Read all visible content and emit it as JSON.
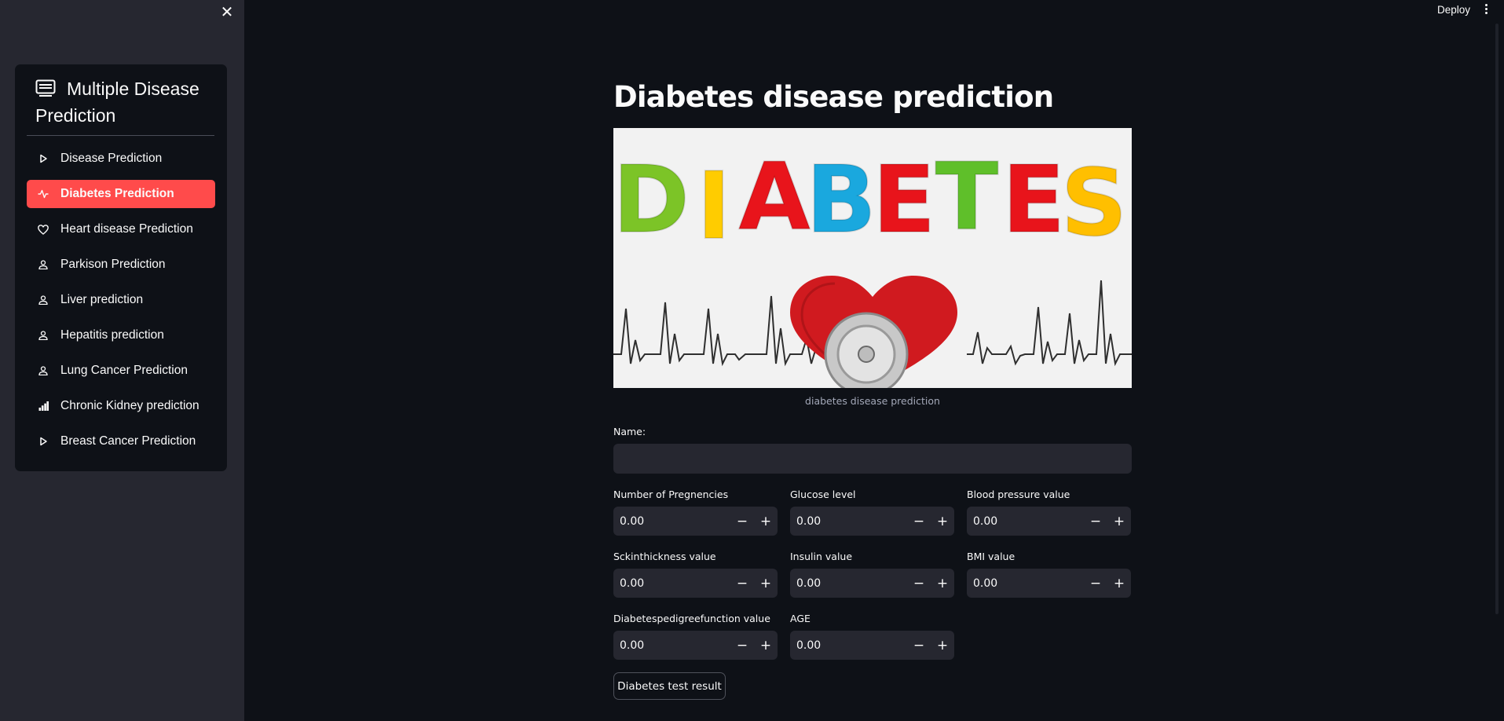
{
  "sidebar": {
    "close_icon": "close-icon",
    "menu": {
      "title": "Multiple Disease Prediction",
      "title_icon": "list-card-icon",
      "items": [
        {
          "label": "Disease Prediction",
          "icon": "play-icon",
          "active": false
        },
        {
          "label": "Diabetes Prediction",
          "icon": "activity-icon",
          "active": true
        },
        {
          "label": "Heart disease Prediction",
          "icon": "heart-icon",
          "active": false
        },
        {
          "label": "Parkison Prediction",
          "icon": "person-icon",
          "active": false
        },
        {
          "label": "Liver prediction",
          "icon": "person-icon",
          "active": false
        },
        {
          "label": "Hepatitis prediction",
          "icon": "person-icon",
          "active": false
        },
        {
          "label": "Lung Cancer Prediction",
          "icon": "person-icon",
          "active": false
        },
        {
          "label": "Chronic Kidney prediction",
          "icon": "bar-chart-icon",
          "active": false
        },
        {
          "label": "Breast Cancer Prediction",
          "icon": "play-icon",
          "active": false
        }
      ]
    }
  },
  "header": {
    "deploy_label": "Deploy",
    "menu_icon": "kebab-menu-icon"
  },
  "main": {
    "title": "Diabetes disease prediction",
    "banner": {
      "text": "DIABETES",
      "caption": "diabetes disease prediction"
    },
    "name_field": {
      "label": "Name:",
      "value": ""
    },
    "fields": [
      {
        "label": "Number of Pregnencies",
        "value": "0.00"
      },
      {
        "label": "Glucose level",
        "value": "0.00"
      },
      {
        "label": "Blood pressure value",
        "value": "0.00"
      },
      {
        "label": "Sckinthickness value",
        "value": "0.00"
      },
      {
        "label": "Insulin value",
        "value": "0.00"
      },
      {
        "label": "BMI value",
        "value": "0.00"
      },
      {
        "label": "Diabetespedigreefunction value",
        "value": "0.00"
      },
      {
        "label": "AGE",
        "value": "0.00"
      }
    ],
    "stepper": {
      "minus": "−",
      "plus": "+"
    },
    "submit_label": "Diabetes test result"
  },
  "colors": {
    "background": "#0e1117",
    "sidebar": "#262730",
    "accent": "#ff4b4b",
    "input": "#262730",
    "banner_letters": [
      "#7cc427",
      "#ffcc00",
      "#e8141b",
      "#1aa8de",
      "#e8141b",
      "#5fbf2a",
      "#e8141b",
      "#ffbf00"
    ]
  }
}
